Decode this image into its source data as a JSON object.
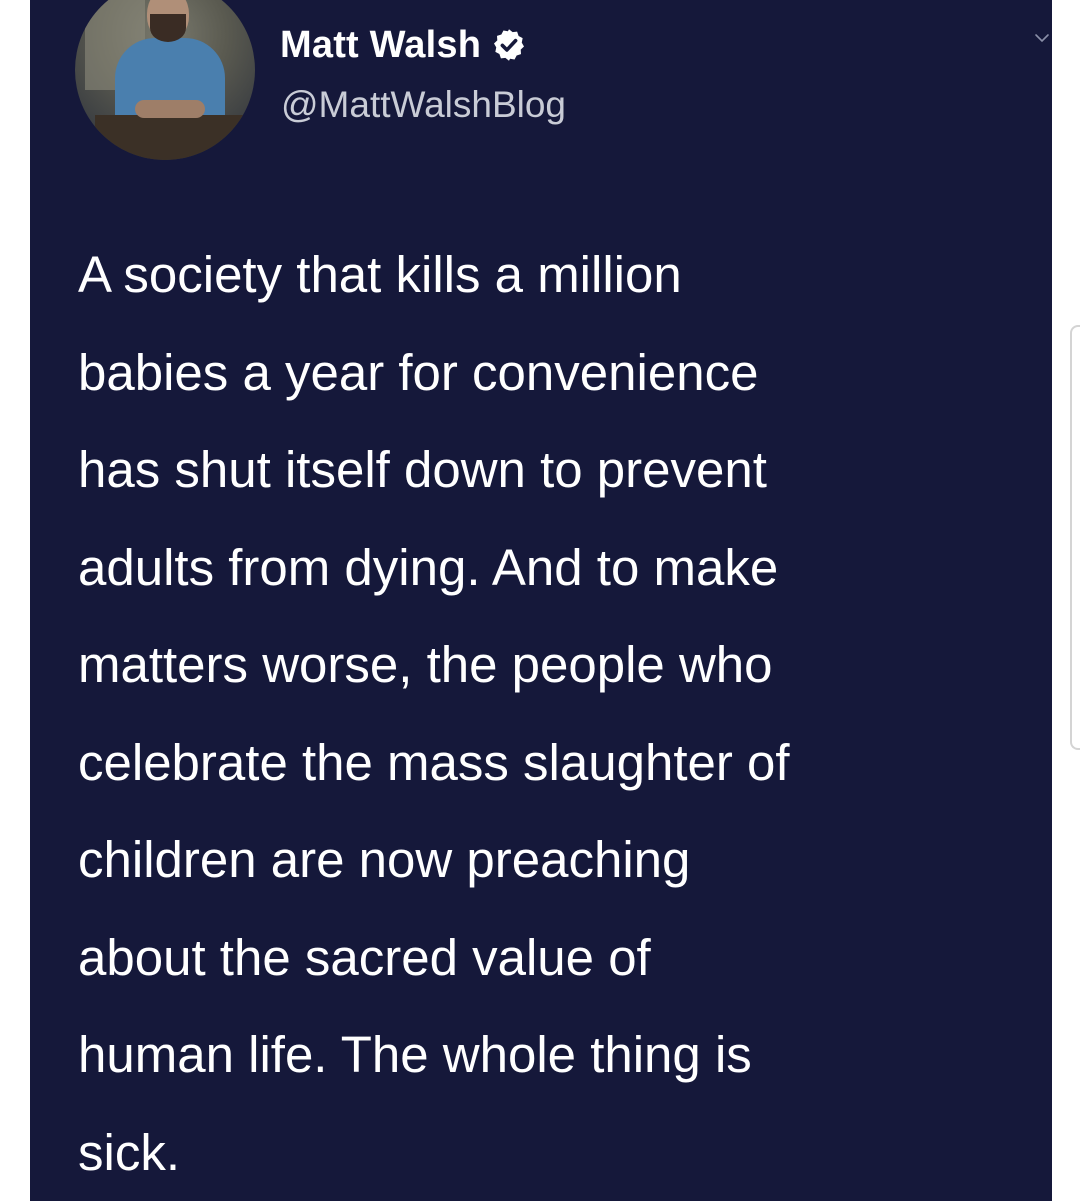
{
  "author": {
    "display_name": "Matt Walsh",
    "handle": "@MattWalshBlog",
    "verified": true
  },
  "icons": {
    "verified": "verified-badge-icon",
    "menu": "chevron-down-icon",
    "avatar": "profile-avatar"
  },
  "tweet": {
    "lines": [
      "A society that kills a million",
      "babies a year for convenience",
      "has shut itself down to prevent",
      "adults from dying. And to make",
      "matters worse, the people who",
      "celebrate the mass slaughter of",
      "children are now preaching",
      "about the sacred value of",
      "human life. The whole thing is",
      "sick."
    ]
  },
  "colors": {
    "card_background": "#15183a",
    "page_background": "#ffffff",
    "text_primary": "#ffffff",
    "text_secondary": "#c9ccd6",
    "verified_badge": "#ffffff"
  }
}
